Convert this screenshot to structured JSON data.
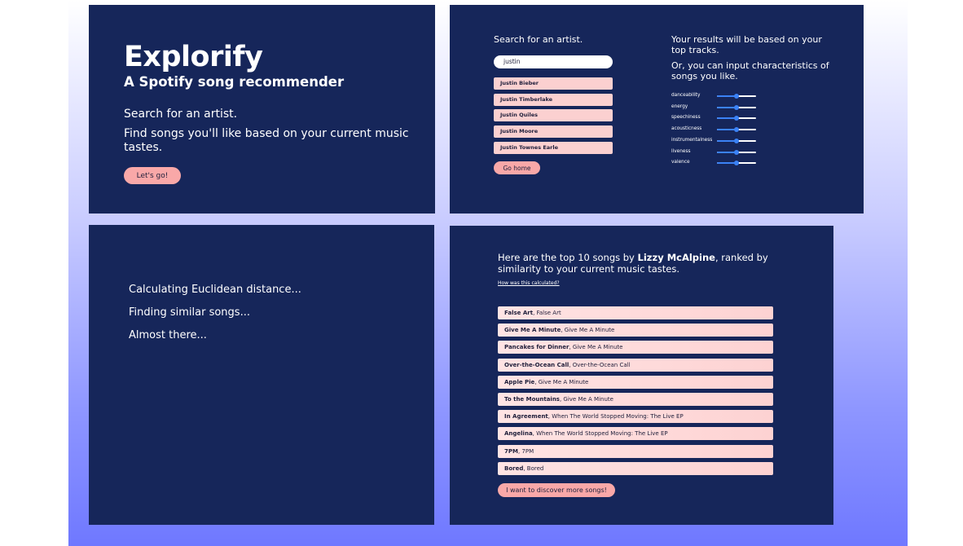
{
  "hero": {
    "title": "Explorify",
    "subtitle": "A Spotify song recommender",
    "line1": "Search for an artist.",
    "line2": "Find songs you'll like based on your current music tastes.",
    "button": "Let's go!"
  },
  "search": {
    "label": "Search for an artist.",
    "value": "justin",
    "results": [
      "Justin Bieber",
      "Justin Timberlake",
      "Justin Quiles",
      "Justin Moore",
      "Justin Townes Earle"
    ],
    "home_button": "Go home",
    "results_note": "Your results will be based on your top tracks.",
    "or_note": "Or, you can input characteristics of songs you like."
  },
  "sliders": [
    {
      "label": "danceability",
      "value": 0.5
    },
    {
      "label": "energy",
      "value": 0.5
    },
    {
      "label": "speechiness",
      "value": 0.5
    },
    {
      "label": "acousticness",
      "value": 0.5
    },
    {
      "label": "instrumentalness",
      "value": 0.5
    },
    {
      "label": "liveness",
      "value": 0.5
    },
    {
      "label": "valence",
      "value": 0.5
    }
  ],
  "loading": {
    "lines": [
      "Calculating Euclidean distance...",
      "Finding similar songs...",
      "Almost there..."
    ]
  },
  "results": {
    "heading_prefix": "Here are the top 10 songs by ",
    "artist": "Lizzy McAlpine",
    "heading_suffix": ", ranked by similarity to your current music tastes.",
    "link": "How was this calculated?",
    "songs": [
      {
        "title": "False Art",
        "album": ", False Art"
      },
      {
        "title": "Give Me A Minute",
        "album": ", Give Me A Minute"
      },
      {
        "title": "Pancakes for Dinner",
        "album": ", Give Me A Minute"
      },
      {
        "title": "Over-the-Ocean Call",
        "album": ", Over-the-Ocean Call"
      },
      {
        "title": "Apple Pie",
        "album": ", Give Me A Minute"
      },
      {
        "title": "To the Mountains",
        "album": ", Give Me A Minute"
      },
      {
        "title": "In Agreement",
        "album": ", When The World Stopped Moving: The Live EP"
      },
      {
        "title": "Angelina",
        "album": ", When The World Stopped Moving: The Live EP"
      },
      {
        "title": "7PM",
        "album": ", 7PM"
      },
      {
        "title": "Bored",
        "album": ", Bored"
      }
    ],
    "button": "I want to discover more songs!"
  },
  "colors": {
    "panel": "#16265a",
    "accent_button": "#f9a8a8",
    "list_item": "#fbd0d0",
    "slider": "#3b82f6"
  }
}
